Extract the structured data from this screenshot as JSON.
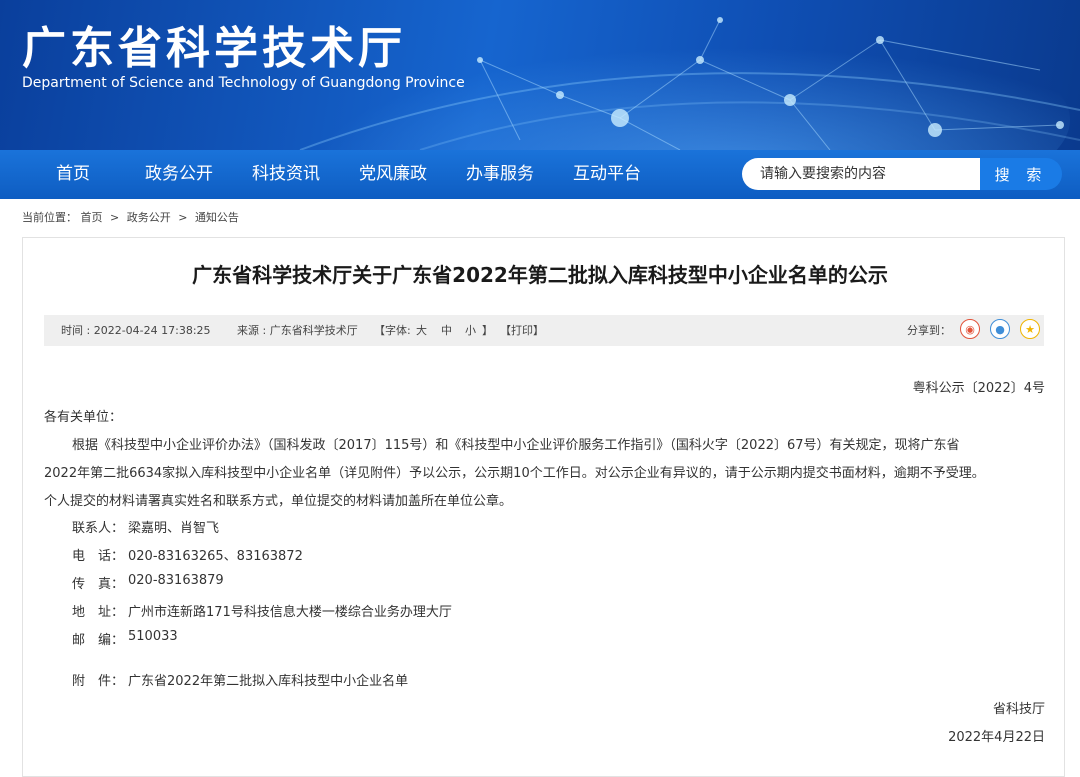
{
  "header": {
    "title": "广东省科学技术厅",
    "subtitle": "Department of Science and Technology of Guangdong Province"
  },
  "nav": {
    "items": [
      {
        "label": "首页"
      },
      {
        "label": "政务公开"
      },
      {
        "label": "科技资讯"
      },
      {
        "label": "党风廉政"
      },
      {
        "label": "办事服务"
      },
      {
        "label": "互动平台"
      }
    ],
    "search": {
      "placeholder": "请输入要搜索的内容",
      "button_label": "搜 索"
    }
  },
  "breadcrumb": {
    "prefix": "当前位置：",
    "items": [
      "首页",
      "政务公开",
      "通知公告"
    ],
    "separator": ">"
  },
  "article": {
    "title": "广东省科学技术厅关于广东省2022年第二批拟入库科技型中小企业名单的公示",
    "meta": {
      "time": "时间 : 2022-04-24 17:38:25",
      "source": "来源 : 广东省科学技术厅",
      "font_label": "【字体:",
      "font_large": "大",
      "font_medium": "中",
      "font_small": "小",
      "font_close": "】",
      "print": "【打印】",
      "share_label": "分享到："
    },
    "doc_number": "粤科公示〔2022〕4号",
    "greeting": "各有关单位：",
    "body_lines": [
      "根据《科技型中小企业评价办法》（国科发政〔2017〕115号）和《科技型中小企业评价服务工作指引》（国科火字〔2022〕67号）有关规定，现将广东省",
      "2022年第二批6634家拟入库科技型中小企业名单（详见附件）予以公示，公示期10个工作日。对公示企业有异议的，请于公示期内提交书面材料，逾期不予受理。",
      "个人提交的材料请署真实姓名和联系方式，单位提交的材料请加盖所在单位公章。"
    ],
    "contacts": [
      {
        "label": "联系人：",
        "value": "梁嘉明、肖智飞"
      },
      {
        "label": "电　话：",
        "value": "020-83163265、83163872"
      },
      {
        "label": "传　真：",
        "value": "020-83163879"
      },
      {
        "label": "地　址：",
        "value": "广州市连新路171号科技信息大楼一楼综合业务办理大厅"
      },
      {
        "label": "邮　编：",
        "value": "510033"
      }
    ],
    "attachment": {
      "label": "附　件：",
      "link": "广东省2022年第二批拟入库科技型中小企业名单"
    },
    "signature": "省科技厅",
    "date": "2022年4月22日"
  },
  "colors": {
    "banner_blue": "#1665cf",
    "nav_blue": "#0e5dc2",
    "weibo_red": "#e2533a",
    "qq_blue": "#3f8ed8",
    "qzone_yellow": "#f0b400"
  },
  "icons": {
    "share": [
      "weibo-icon",
      "qq-icon",
      "qzone-star-icon"
    ]
  }
}
